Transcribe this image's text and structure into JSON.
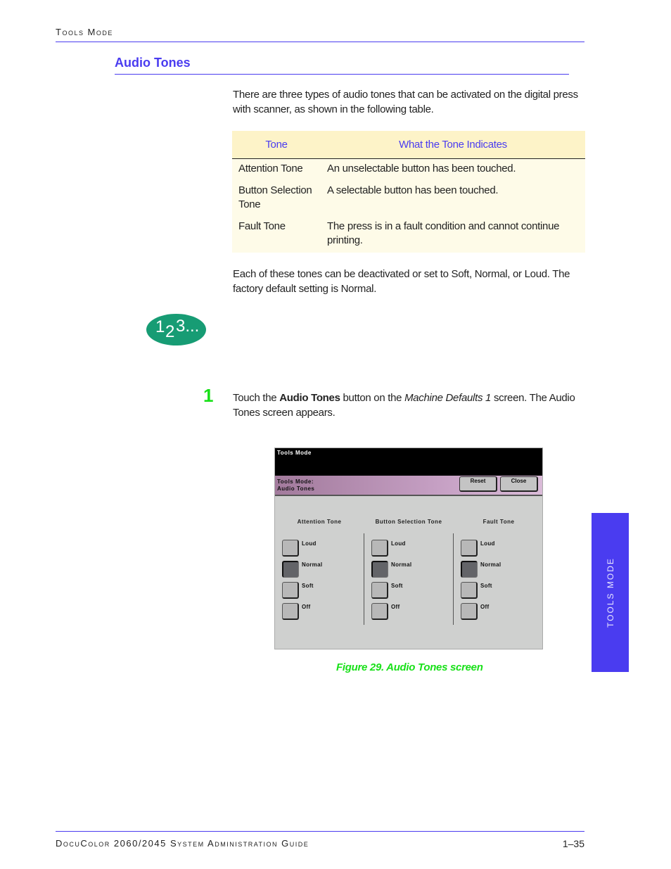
{
  "header": {
    "running_title": "Tools Mode"
  },
  "section": {
    "title": "Audio Tones",
    "intro": "There are three types of audio tones that can be activated on the digital press with scanner, as shown in the following table.",
    "after_table": "Each of these tones can be deactivated or set to Soft, Normal, or Loud. The factory default setting is Normal."
  },
  "table": {
    "headers": [
      "Tone",
      "What the Tone Indicates"
    ],
    "rows": [
      [
        "Attention Tone",
        "An unselectable button has been touched."
      ],
      [
        "Button Selection Tone",
        "A selectable button has been touched."
      ],
      [
        "Fault Tone",
        "The press is in a fault condition and cannot continue printing."
      ]
    ]
  },
  "steps_icon": {
    "d1": "1",
    "d2": "2",
    "d3": "3..."
  },
  "step": {
    "number": "1",
    "text_pre": "Touch the ",
    "text_bold": "Audio Tones",
    "text_mid": " button on the ",
    "text_italic": "Machine Defaults 1",
    "text_post": " screen. The Audio Tones screen appears."
  },
  "screen": {
    "title": "Tools Mode",
    "sub_line1": "Tools Mode:",
    "sub_line2": "Audio Tones",
    "reset_label": "Reset",
    "close_label": "Close",
    "columns": [
      {
        "title": "Attention Tone",
        "options": [
          "Loud",
          "Normal",
          "Soft",
          "Off"
        ],
        "selected": "Normal"
      },
      {
        "title": "Button Selection Tone",
        "options": [
          "Loud",
          "Normal",
          "Soft",
          "Off"
        ],
        "selected": "Normal"
      },
      {
        "title": "Fault Tone",
        "options": [
          "Loud",
          "Normal",
          "Soft",
          "Off"
        ],
        "selected": "Normal"
      }
    ]
  },
  "figure_caption": "Figure 29. Audio Tones screen",
  "side_tab": "TOOLS MODE",
  "footer": {
    "title": "DocuColor 2060/2045 System Administration Guide",
    "page": "1–35"
  },
  "colors": {
    "accent": "#4a3cf0",
    "step_green": "#18e018",
    "badge_green": "#179c74",
    "table_header_bg": "#fdf3c8",
    "table_body_bg": "#fefbe8"
  }
}
